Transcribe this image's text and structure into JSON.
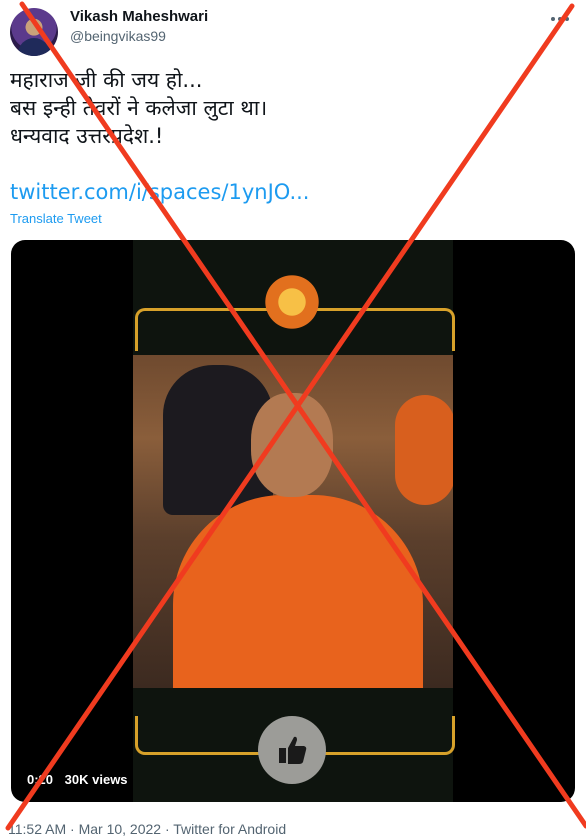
{
  "author": {
    "name": "Vikash Maheshwari",
    "handle": "@beingvikas99",
    "more_icon": "ellipsis-icon"
  },
  "tweet": {
    "lines": [
      "महाराज जी की जय हो...",
      "बस इन्ही तेवरों ने कलेजा लुटा था।",
      "धन्यवाद उत्तरप्रदेश.!"
    ],
    "link": "twitter.com/i/spaces/1ynJO...",
    "translate": "Translate Tweet"
  },
  "media": {
    "time": "0:20",
    "views": "30K views",
    "like_icon": "thumbs-up-icon"
  },
  "meta": {
    "time": "11:52 AM",
    "sep1": "·",
    "date": "Mar 10, 2022",
    "sep2": "·",
    "source": "Twitter for Android"
  },
  "colors": {
    "accent": "#1d9bf0",
    "cross": "#f03b1f",
    "robe": "#e8631d",
    "gold": "#d7a12a"
  }
}
